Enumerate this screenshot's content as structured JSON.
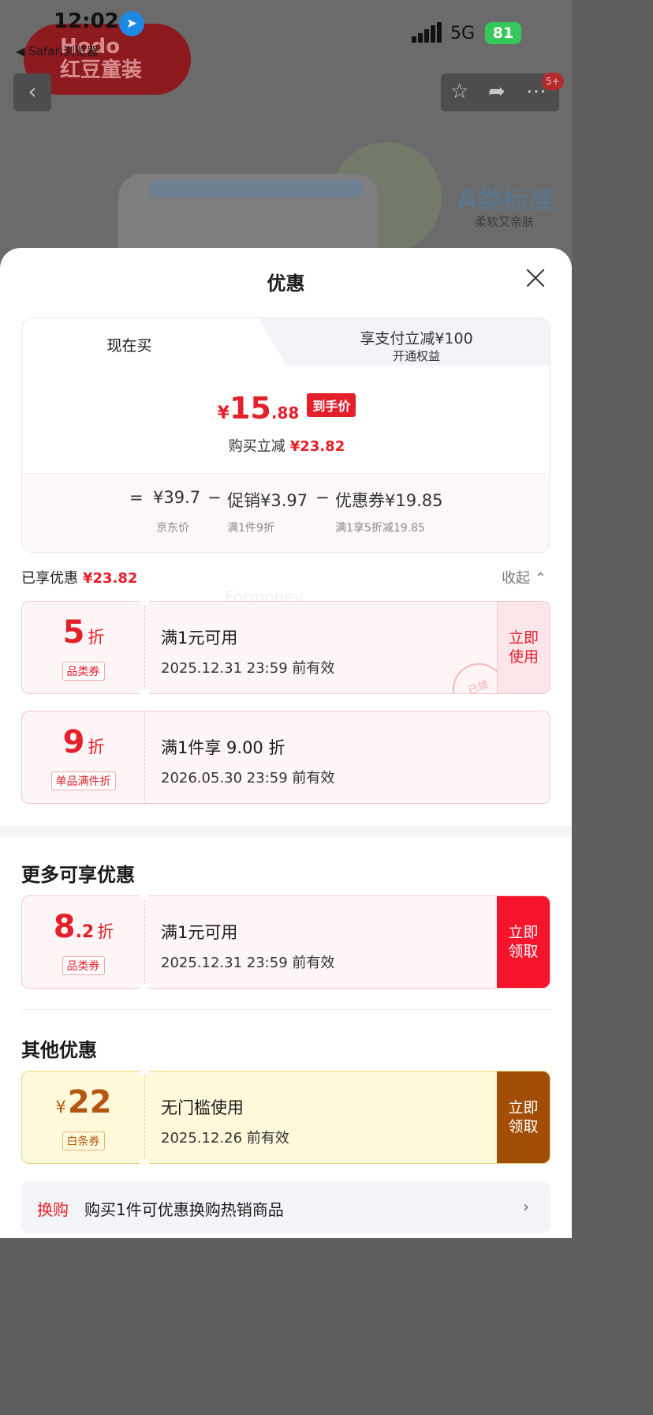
{
  "status_bar": {
    "time": "12:02",
    "back_app": "◀ Safari浏览器",
    "network": "5G",
    "battery": "81"
  },
  "background": {
    "brand": "红豆童装",
    "brand_en": "Hodo",
    "feature_title": "A类标准",
    "feature_sub": "柔软又亲肤",
    "cart_badge": "5+"
  },
  "sheet": {
    "title": "优惠",
    "tabs": {
      "now": "现在买",
      "pay_line1": "享支付立减¥100",
      "pay_line2": "开通权益"
    },
    "final_price": {
      "currency": "¥",
      "integer": "15",
      "decimal": ".88",
      "tag": "到手价"
    },
    "saved": {
      "label": "购买立减",
      "amount": "¥23.82"
    },
    "calc": {
      "eq": "=",
      "jd_price": "¥39.7",
      "jd_label": "京东价",
      "minus1": "−",
      "promo": "促销¥3.97",
      "promo_label": "满1件9折",
      "minus2": "−",
      "coupon": "优惠券¥19.85",
      "coupon_label": "满1享5折减19.85"
    },
    "enjoyed": {
      "label": "已享优惠",
      "amount": "¥23.82",
      "collapse": "收起 ⌃"
    },
    "watermark": "Formoney"
  },
  "enjoyed_coupons": [
    {
      "big": "5",
      "dec": "",
      "unit": "折",
      "tag": "品类券",
      "cond": "满1元可用",
      "valid": "2025.12.31 23:59 前有效",
      "action": "立即使用",
      "stamp": "已领"
    },
    {
      "big": "9",
      "dec": "",
      "unit": "折",
      "tag": "单品满件折",
      "cond": "满1件享 9.00 折",
      "valid": "2026.05.30 23:59 前有效"
    }
  ],
  "more": {
    "title": "更多可享优惠",
    "coupon": {
      "big": "8",
      "dec": ".2",
      "unit": "折",
      "tag": "品类券",
      "cond": "满1元可用",
      "valid": "2025.12.31 23:59 前有效",
      "action": "立即领取"
    }
  },
  "other": {
    "title": "其他优惠",
    "coupon": {
      "cur": "¥",
      "big": "22",
      "tag": "白条券",
      "cond": "无门槛使用",
      "valid": "2025.12.26 前有效",
      "action": "立即领取"
    },
    "exchange": {
      "label": "换购",
      "text": "购买1件可优惠换购热销商品",
      "chevron": "›"
    }
  },
  "colors": {
    "accent_red": "#e4202b",
    "claim_red": "#f6142d",
    "claim_brown": "#a24e07"
  }
}
